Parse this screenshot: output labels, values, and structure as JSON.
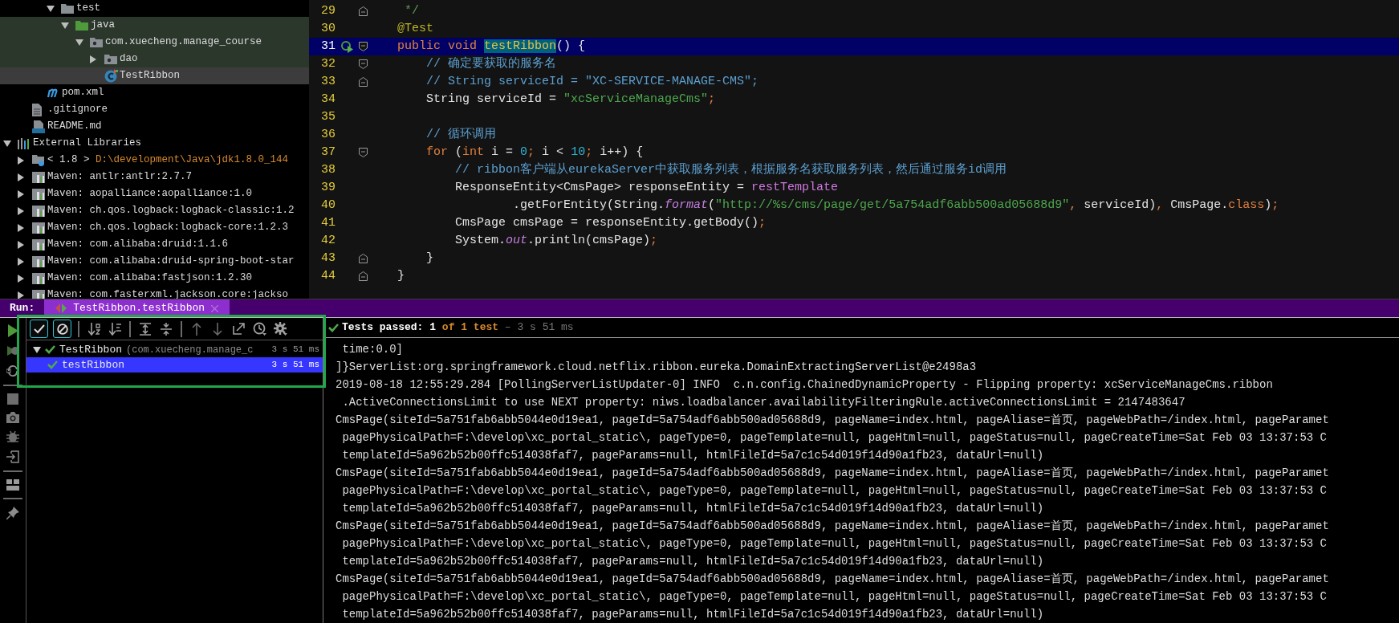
{
  "project_tree": {
    "items": [
      {
        "children": [
          {
            "children": [
              {
                "children": [
                  {
                    "label": "test",
                    "kind": "folder",
                    "expanded": true,
                    "selected": false,
                    "test_scope": false,
                    "children": [
                      {
                        "label": "java",
                        "kind": "source-folder",
                        "expanded": true,
                        "selected": false,
                        "test_scope": true,
                        "children": [
                          {
                            "label": "com.xuecheng.manage_course",
                            "kind": "package",
                            "expanded": true,
                            "selected": false,
                            "test_scope": true,
                            "children": [
                              {
                                "label": "dao",
                                "kind": "package",
                                "expanded": false,
                                "selected": false,
                                "test_scope": true
                              },
                              {
                                "label": "TestRibbon",
                                "kind": "class",
                                "selected": true,
                                "test_scope": true
                              }
                            ]
                          }
                        ]
                      }
                    ]
                  }
                ]
              },
              {
                "label": "pom.xml",
                "kind": "maven",
                "selected": false,
                "test_scope": false
              }
            ]
          },
          {
            "label": ".gitignore",
            "kind": "text-file",
            "selected": false,
            "test_scope": false
          },
          {
            "label": "README.md",
            "kind": "markdown",
            "selected": false,
            "test_scope": false
          }
        ]
      },
      {
        "label": "External Libraries",
        "kind": "libraries",
        "expanded": true,
        "selected": false,
        "test_scope": false,
        "children": [
          {
            "label": "< 1.8 >",
            "path": "D:\\development\\Java\\jdk1.8.0_144",
            "kind": "jdk",
            "expanded": false,
            "selected": false,
            "test_scope": false
          },
          {
            "label": "Maven: antlr:antlr:2.7.7",
            "kind": "library",
            "expanded": false,
            "selected": false,
            "test_scope": false
          },
          {
            "label": "Maven: aopalliance:aopalliance:1.0",
            "kind": "library",
            "expanded": false,
            "selected": false,
            "test_scope": false
          },
          {
            "label": "Maven: ch.qos.logback:logback-classic:1.2",
            "kind": "library",
            "expanded": false,
            "selected": false,
            "test_scope": false
          },
          {
            "label": "Maven: ch.qos.logback:logback-core:1.2.3",
            "kind": "library",
            "expanded": false,
            "selected": false,
            "test_scope": false
          },
          {
            "label": "Maven: com.alibaba:druid:1.1.6",
            "kind": "library",
            "expanded": false,
            "selected": false,
            "test_scope": false
          },
          {
            "label": "Maven: com.alibaba:druid-spring-boot-star",
            "kind": "library",
            "expanded": false,
            "selected": false,
            "test_scope": false
          },
          {
            "label": "Maven: com.alibaba:fastjson:1.2.30",
            "kind": "library",
            "expanded": false,
            "selected": false,
            "test_scope": false
          },
          {
            "label": "Maven: com.fasterxml.jackson.core:jackso",
            "kind": "library",
            "expanded": false,
            "selected": false,
            "test_scope": false
          }
        ]
      }
    ]
  },
  "editor": {
    "lines": [
      {
        "number": "29",
        "fold_marker": {
          "kind": "end"
        },
        "current": false,
        "tokens": [
          {
            "text": "     */",
            "kind": "doc"
          }
        ]
      },
      {
        "number": "30",
        "current": false,
        "tokens": [
          {
            "text": "    @Test",
            "kind": "annotation"
          }
        ]
      },
      {
        "number": "31",
        "fold_marker": {
          "kind": "start"
        },
        "run": true,
        "current": true,
        "tokens": [
          {
            "text": "    public void ",
            "kind": "keyword"
          },
          {
            "text": "testRibbon",
            "kind": "match"
          },
          {
            "text": "() {",
            "kind": "plain"
          }
        ]
      },
      {
        "number": "32",
        "fold_marker": {
          "kind": "start"
        },
        "current": false,
        "tokens": [
          {
            "text": "        // 确定要获取的服务名",
            "kind": "comment"
          }
        ]
      },
      {
        "number": "33",
        "fold_marker": {
          "kind": "end"
        },
        "current": false,
        "tokens": [
          {
            "text": "        // String serviceId = \"XC-SERVICE-MANAGE-CMS\";",
            "kind": "comment"
          }
        ]
      },
      {
        "number": "34",
        "current": false,
        "tokens": [
          {
            "text": "        String serviceId = ",
            "kind": "plain"
          },
          {
            "text": "\"xcServiceManageCms\"",
            "kind": "string"
          },
          {
            "text": ";",
            "kind": "keyword"
          }
        ]
      },
      {
        "number": "35",
        "current": false
      },
      {
        "number": "36",
        "current": false,
        "tokens": [
          {
            "text": "        // 循环调用",
            "kind": "comment"
          }
        ]
      },
      {
        "number": "37",
        "fold_marker": {
          "kind": "start"
        },
        "current": false,
        "tokens": [
          {
            "text": "        for",
            "kind": "keyword"
          },
          {
            "text": " (",
            "kind": "plain"
          },
          {
            "text": "int",
            "kind": "keyword"
          },
          {
            "text": " i = ",
            "kind": "plain"
          },
          {
            "text": "0",
            "kind": "number"
          },
          {
            "text": ";",
            "kind": "keyword"
          },
          {
            "text": " i < ",
            "kind": "plain"
          },
          {
            "text": "10",
            "kind": "number"
          },
          {
            "text": ";",
            "kind": "keyword"
          },
          {
            "text": " i++) {",
            "kind": "plain"
          }
        ]
      },
      {
        "number": "38",
        "current": false,
        "tokens": [
          {
            "text": "            // ribbon客户端从eurekaServer中获取服务列表，根据服务名获取服务列表，然后通过服务id调用",
            "kind": "comment"
          }
        ]
      },
      {
        "number": "39",
        "current": false,
        "tokens": [
          {
            "text": "            ResponseEntity<CmsPage> responseEntity = ",
            "kind": "plain"
          },
          {
            "text": "restTemplate",
            "kind": "field"
          }
        ]
      },
      {
        "number": "40",
        "current": false,
        "tokens": [
          {
            "text": "                    .getForEntity(String.",
            "kind": "plain"
          },
          {
            "text": "format",
            "kind": "static"
          },
          {
            "text": "(",
            "kind": "plain"
          },
          {
            "text": "\"http://%s/cms/page/get/5a754adf6abb500ad05688d9\"",
            "kind": "string"
          },
          {
            "text": ",",
            "kind": "keyword"
          },
          {
            "text": " serviceId)",
            "kind": "plain"
          },
          {
            "text": ",",
            "kind": "keyword"
          },
          {
            "text": " CmsPage.",
            "kind": "plain"
          },
          {
            "text": "class",
            "kind": "keyword"
          },
          {
            "text": ")",
            "kind": "plain"
          },
          {
            "text": ";",
            "kind": "keyword"
          }
        ]
      },
      {
        "number": "41",
        "current": false,
        "tokens": [
          {
            "text": "            CmsPage cmsPage = responseEntity.getBody()",
            "kind": "plain"
          },
          {
            "text": ";",
            "kind": "keyword"
          }
        ]
      },
      {
        "number": "42",
        "current": false,
        "tokens": [
          {
            "text": "            System.",
            "kind": "plain"
          },
          {
            "text": "out",
            "kind": "static"
          },
          {
            "text": ".println(cmsPage)",
            "kind": "plain"
          },
          {
            "text": ";",
            "kind": "keyword"
          }
        ]
      },
      {
        "number": "43",
        "fold_marker": {
          "kind": "end"
        },
        "current": false,
        "tokens": [
          {
            "text": "        }",
            "kind": "plain"
          }
        ]
      },
      {
        "number": "44",
        "fold_marker": {
          "kind": "end"
        },
        "current": false,
        "tokens": [
          {
            "text": "    }",
            "kind": "plain"
          }
        ]
      }
    ]
  },
  "run_panel": {
    "label": "Run:",
    "tab": {
      "label": "TestRibbon.testRibbon",
      "selected": true
    },
    "side_tools": [
      {
        "kind": "run"
      },
      {
        "kind": "rerun-failed"
      },
      {
        "kind": "auto-test"
      },
      {
        "kind": "separator"
      },
      {
        "kind": "stop"
      },
      {
        "kind": "camera"
      },
      {
        "kind": "bug"
      },
      {
        "kind": "import"
      },
      {
        "kind": "separator"
      },
      {
        "kind": "layout"
      },
      {
        "kind": "separator"
      },
      {
        "kind": "pin"
      }
    ],
    "toolbar": [
      {
        "kind": "show-passed",
        "on": true
      },
      {
        "kind": "show-ignored",
        "on": true
      },
      {
        "kind": "separator"
      },
      {
        "kind": "sort-alpha"
      },
      {
        "kind": "sort-duration"
      },
      {
        "kind": "separator"
      },
      {
        "kind": "expand-all"
      },
      {
        "kind": "collapse-all"
      },
      {
        "kind": "separator"
      },
      {
        "kind": "previous"
      },
      {
        "kind": "next"
      },
      {
        "kind": "export"
      },
      {
        "kind": "history"
      },
      {
        "kind": "settings"
      }
    ],
    "test_tree": [
      {
        "label": "TestRibbon",
        "detail": "(com.xuecheng.manage_c",
        "duration": "3 s 51 ms",
        "status": {
          "kind": "passed"
        },
        "expanded": true,
        "selected": false,
        "children": [
          {
            "label": "testRibbon",
            "duration": "3 s 51 ms",
            "status": {
              "kind": "passed"
            },
            "selected": true
          }
        ]
      }
    ],
    "summary": {
      "status": {
        "kind": "passed"
      },
      "label": "Tests passed:",
      "passed": "1",
      "total": "of 1 test",
      "duration": "– 3 s 51 ms"
    },
    "console": [
      " time:0.0]",
      "]}ServerList:org.springframework.cloud.netflix.ribbon.eureka.DomainExtractingServerList@e2498a3",
      "2019-08-18 12:55:29.284 [PollingServerListUpdater-0] INFO  c.n.config.ChainedDynamicProperty - Flipping property: xcServiceManageCms.ribbon",
      " .ActiveConnectionsLimit to use NEXT property: niws.loadbalancer.availabilityFilteringRule.activeConnectionsLimit = 2147483647",
      "CmsPage(siteId=5a751fab6abb5044e0d19ea1, pageId=5a754adf6abb500ad05688d9, pageName=index.html, pageAliase=首页, pageWebPath=/index.html, pageParamet",
      " pagePhysicalPath=F:\\develop\\xc_portal_static\\, pageType=0, pageTemplate=null, pageHtml=null, pageStatus=null, pageCreateTime=Sat Feb 03 13:37:53 C",
      " templateId=5a962b52b00ffc514038faf7, pageParams=null, htmlFileId=5a7c1c54d019f14d90a1fb23, dataUrl=null)",
      "CmsPage(siteId=5a751fab6abb5044e0d19ea1, pageId=5a754adf6abb500ad05688d9, pageName=index.html, pageAliase=首页, pageWebPath=/index.html, pageParamet",
      " pagePhysicalPath=F:\\develop\\xc_portal_static\\, pageType=0, pageTemplate=null, pageHtml=null, pageStatus=null, pageCreateTime=Sat Feb 03 13:37:53 C",
      " templateId=5a962b52b00ffc514038faf7, pageParams=null, htmlFileId=5a7c1c54d019f14d90a1fb23, dataUrl=null)",
      "CmsPage(siteId=5a751fab6abb5044e0d19ea1, pageId=5a754adf6abb500ad05688d9, pageName=index.html, pageAliase=首页, pageWebPath=/index.html, pageParamet",
      " pagePhysicalPath=F:\\develop\\xc_portal_static\\, pageType=0, pageTemplate=null, pageHtml=null, pageStatus=null, pageCreateTime=Sat Feb 03 13:37:53 C",
      " templateId=5a962b52b00ffc514038faf7, pageParams=null, htmlFileId=5a7c1c54d019f14d90a1fb23, dataUrl=null)",
      "CmsPage(siteId=5a751fab6abb5044e0d19ea1, pageId=5a754adf6abb500ad05688d9, pageName=index.html, pageAliase=首页, pageWebPath=/index.html, pageParamet",
      " pagePhysicalPath=F:\\develop\\xc_portal_static\\, pageType=0, pageTemplate=null, pageHtml=null, pageStatus=null, pageCreateTime=Sat Feb 03 13:37:53 C",
      " templateId=5a962b52b00ffc514038faf7, pageParams=null, htmlFileId=5a7c1c54d019f14d90a1fb23, dataUrl=null)"
    ]
  }
}
